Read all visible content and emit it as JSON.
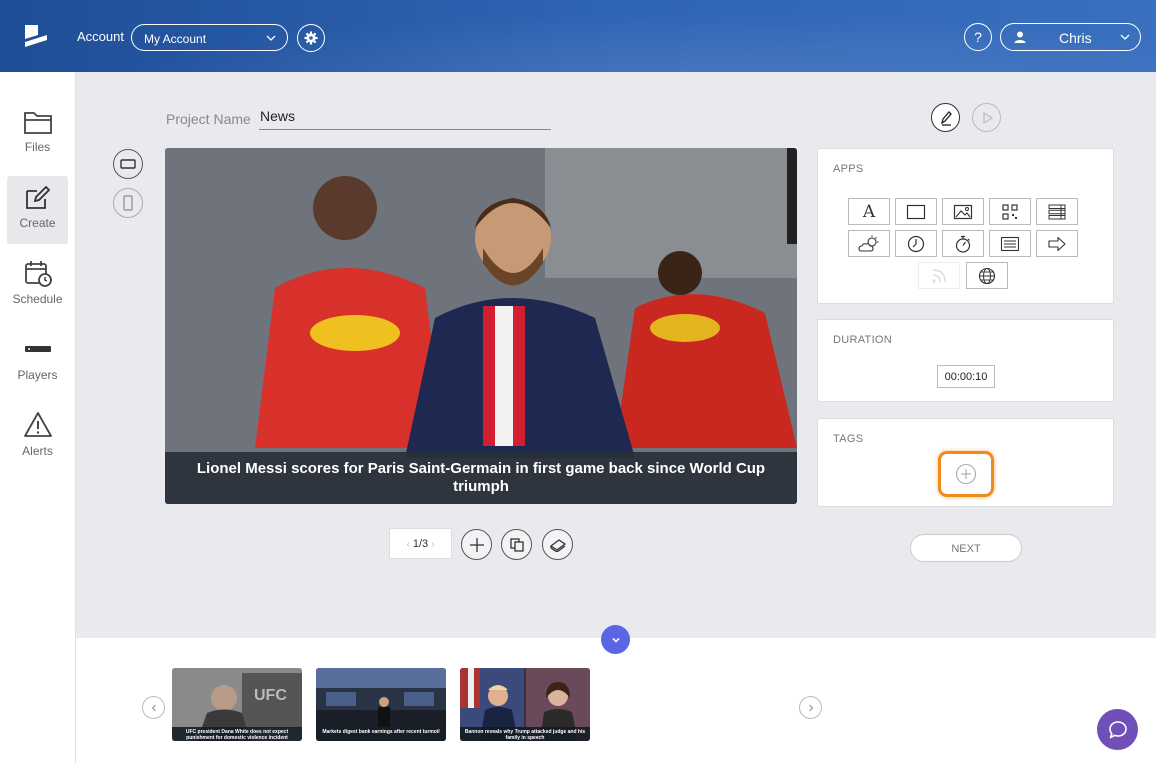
{
  "header": {
    "account_label": "Account",
    "account_selected": "My Account",
    "help_label": "?",
    "user_name": "Chris"
  },
  "sidebar": {
    "items": [
      {
        "label": "Files",
        "icon": "folder-icon"
      },
      {
        "label": "Create",
        "icon": "create-icon",
        "active": true
      },
      {
        "label": "Schedule",
        "icon": "calendar-clock-icon"
      },
      {
        "label": "Players",
        "icon": "player-device-icon"
      },
      {
        "label": "Alerts",
        "icon": "alert-icon"
      }
    ]
  },
  "project": {
    "name_label": "Project Name",
    "name_value": "News"
  },
  "preview": {
    "caption": "Lionel Messi scores for Paris Saint-Germain in first game back since World Cup triumph"
  },
  "pager": {
    "current": "1/3"
  },
  "apps": {
    "title": "APPS",
    "items": [
      "text-icon",
      "rectangle-icon",
      "image-icon",
      "qr-code-icon",
      "list-layout-icon",
      "weather-icon",
      "clock-icon",
      "stopwatch-icon",
      "document-icon",
      "arrow-right-icon",
      "rss-icon",
      "globe-icon"
    ]
  },
  "duration": {
    "title": "DURATION",
    "value": "00:00:10"
  },
  "tags": {
    "title": "TAGS"
  },
  "next_label": "NEXT",
  "strip": {
    "thumbs": [
      {
        "caption": "UFC president Dana White does not expect punishment for domestic violence incident"
      },
      {
        "caption": "Markets digest bank earnings after recent turmoil"
      },
      {
        "caption": "Bannon reveals why Trump attacked judge and his family in speech"
      }
    ]
  },
  "colors": {
    "header": "#2a5ba8",
    "accent": "#5a66e6",
    "highlight": "#f08a1c",
    "chat": "#7050b8"
  }
}
